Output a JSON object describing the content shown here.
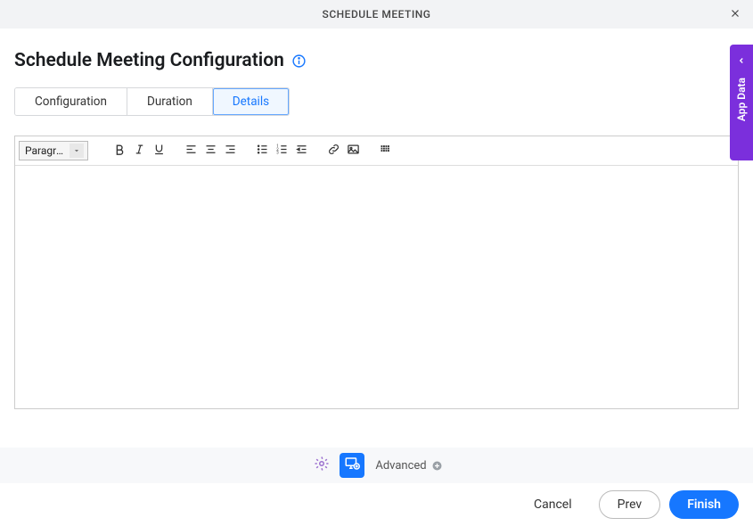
{
  "header": {
    "title": "SCHEDULE MEETING"
  },
  "page": {
    "title": "Schedule Meeting Configuration"
  },
  "tabs": [
    {
      "label": "Configuration"
    },
    {
      "label": "Duration"
    },
    {
      "label": "Details"
    }
  ],
  "editor": {
    "format_select": "Paragra...",
    "content": ""
  },
  "side": {
    "label": "App Data"
  },
  "footer": {
    "advanced_label": "Advanced",
    "cancel": "Cancel",
    "prev": "Prev",
    "finish": "Finish"
  }
}
